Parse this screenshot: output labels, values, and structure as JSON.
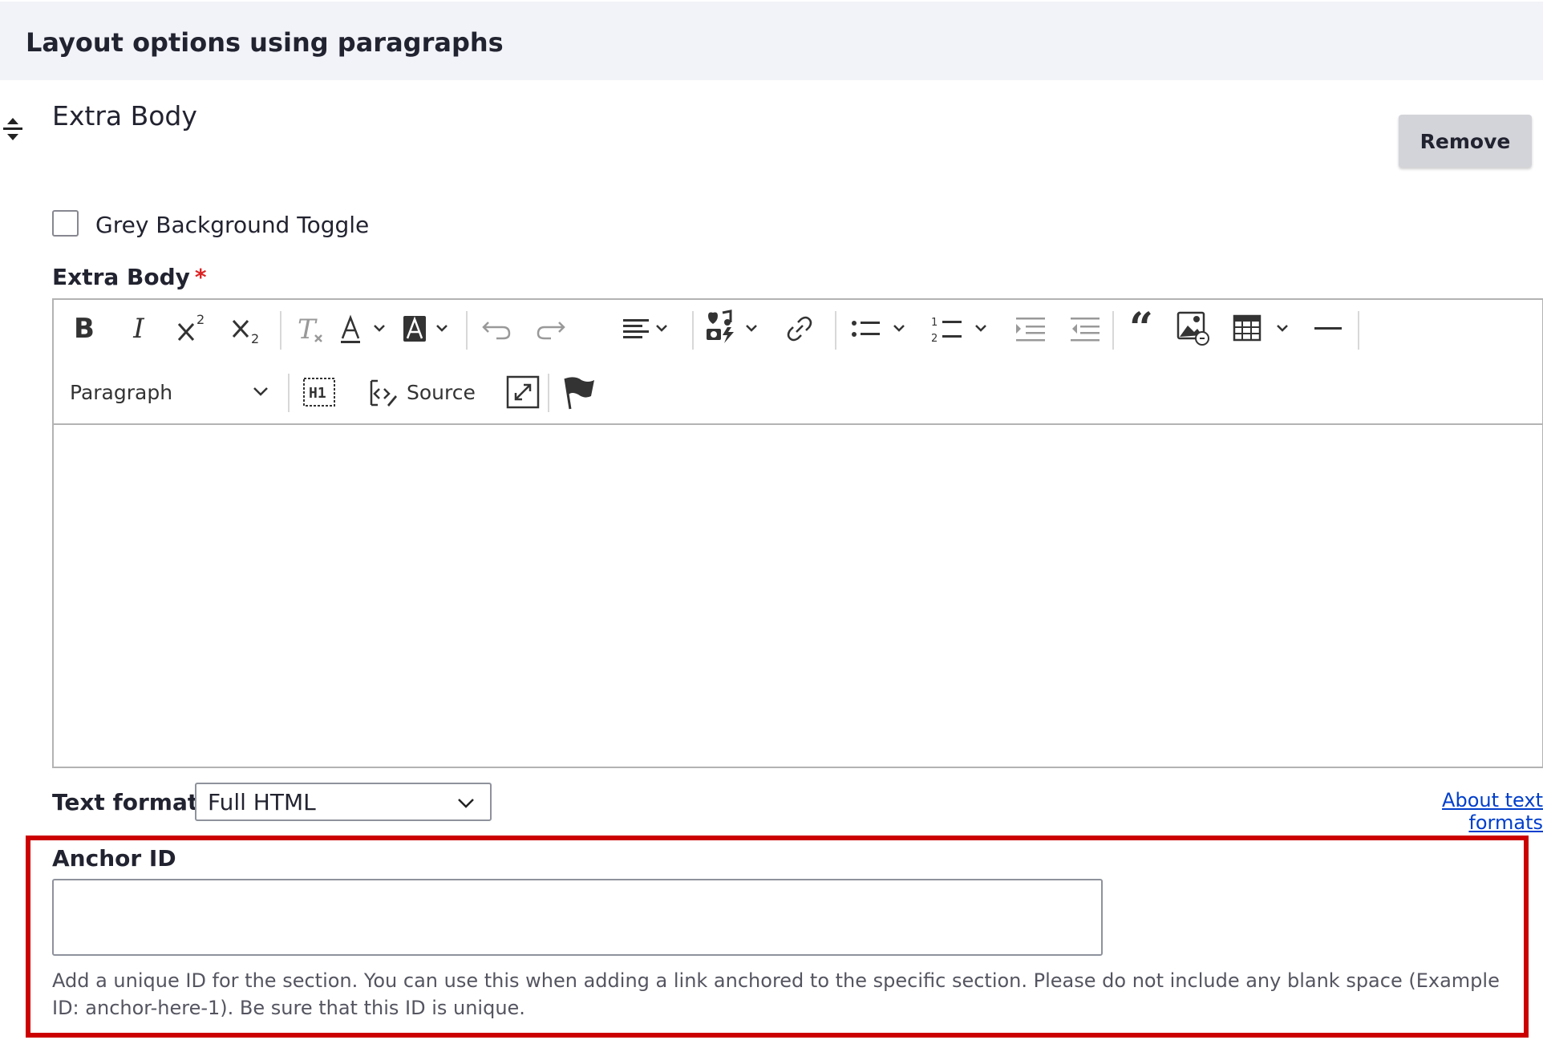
{
  "section": {
    "title": "Layout options using paragraphs"
  },
  "paragraph": {
    "title": "Extra Body",
    "remove_label": "Remove"
  },
  "grey_toggle": {
    "label": "Grey Background Toggle",
    "checked": false
  },
  "extra_body": {
    "label": "Extra Body",
    "required_marker": "*",
    "toolbar": {
      "row1": [
        "bold",
        "italic",
        "superscript",
        "subscript",
        "remove-format",
        "font-color",
        "font-background-color",
        "undo",
        "redo",
        "alignment",
        "media-embed",
        "link",
        "bulleted-list",
        "numbered-list",
        "indent",
        "outdent",
        "block-quote",
        "insert-image",
        "insert-table",
        "horizontal-line"
      ],
      "heading_dropdown": "Paragraph",
      "source_label": "Source",
      "row2_icons": [
        "h1-icon",
        "source-icon",
        "maximize-icon",
        "flag-icon"
      ]
    },
    "content": ""
  },
  "text_format": {
    "label": "Text format",
    "selected": "Full HTML",
    "about_link": "About text formats"
  },
  "anchor": {
    "label": "Anchor ID",
    "value": "",
    "placeholder": "",
    "description": "Add a unique ID for the section. You can use this when adding a link anchored to the specific section. Please do not include any blank space (Example ID: anchor-here-1). Be sure that this ID is unique.",
    "highlight_color": "#cc0000"
  },
  "colors": {
    "required": "#dc2323",
    "link": "#003ecc",
    "header_bg": "#f2f3f8",
    "button_bg": "#d3d4d9"
  }
}
